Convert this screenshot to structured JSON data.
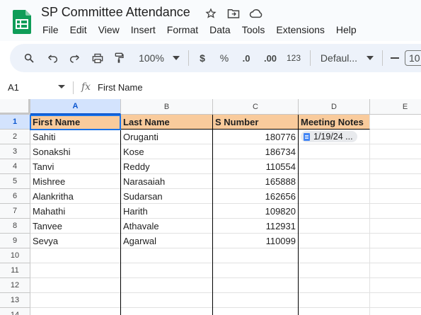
{
  "app": {
    "doc_title": "SP Committee Attendance",
    "menu": [
      "File",
      "Edit",
      "View",
      "Insert",
      "Format",
      "Data",
      "Tools",
      "Extensions",
      "Help"
    ],
    "icons": [
      "star-icon",
      "move-to-folder-icon",
      "cloud-saved-icon"
    ]
  },
  "toolbar": {
    "zoom": "100%",
    "currency": "$",
    "percent": "%",
    "decrease_decimal": ".0",
    "increase_decimal": ".00",
    "number_format": "123",
    "font": "Defaul...",
    "font_size": "10",
    "minus": "—"
  },
  "formula_bar": {
    "cell_ref": "A1",
    "fx": "fx",
    "value": "First Name"
  },
  "grid": {
    "columns": [
      "A",
      "B",
      "C",
      "D",
      "E"
    ],
    "rows": [
      "1",
      "2",
      "3",
      "4",
      "5",
      "6",
      "7",
      "8",
      "9",
      "10",
      "11",
      "12",
      "13",
      "14"
    ],
    "header": [
      "First Name",
      "Last Name",
      "S Number",
      "Meeting Notes"
    ],
    "data": [
      [
        "Sahiti",
        "Oruganti",
        "180776",
        "1/19/24 ..."
      ],
      [
        "Sonakshi",
        "Kose",
        "186734",
        ""
      ],
      [
        "Tanvi",
        "Reddy",
        "110554",
        ""
      ],
      [
        "Mishree",
        "Narasaiah",
        "165888",
        ""
      ],
      [
        "Alankritha",
        "Sudarsan",
        "162656",
        ""
      ],
      [
        "Mahathi",
        "Harith",
        "109820",
        ""
      ],
      [
        "Tanvee",
        "Athavale",
        "112931",
        ""
      ],
      [
        "Sevya",
        "Agarwal",
        "110099",
        ""
      ]
    ]
  },
  "colors": {
    "header_fill": "#f9cb9c",
    "selection": "#1a73e8",
    "sheets_green": "#0f9d58"
  }
}
